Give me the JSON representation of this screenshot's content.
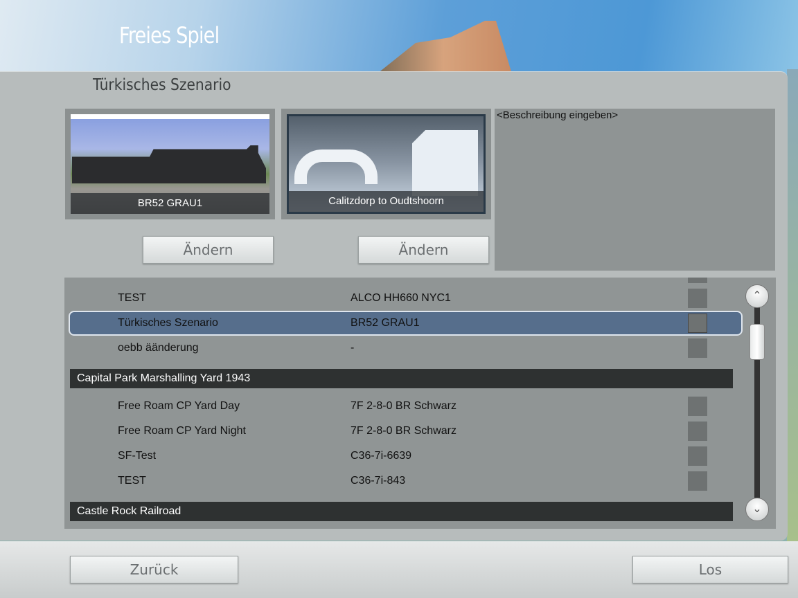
{
  "header": {
    "title": "Freies Spiel"
  },
  "scenario": {
    "name": "Türkisches Szenario",
    "description": "<Beschreibung eingeben>"
  },
  "loco": {
    "caption": "BR52 GRAU1",
    "change_label": "Ändern"
  },
  "route": {
    "caption": "Calitzdorp to Oudtshoorn",
    "change_label": "Ändern"
  },
  "list": {
    "group0_rows": [
      {
        "name": "TEST",
        "vehicle": "ALCO HH660 NYC1"
      },
      {
        "name": "Türkisches Szenario",
        "vehicle": "BR52 GRAU1"
      },
      {
        "name": "oebb äänderung",
        "vehicle": "-"
      }
    ],
    "group1": {
      "title": "Capital Park Marshalling Yard 1943",
      "rows": [
        {
          "name": "Free Roam CP Yard Day",
          "vehicle": "7F 2-8-0 BR Schwarz"
        },
        {
          "name": "Free Roam CP Yard Night",
          "vehicle": "7F 2-8-0 BR Schwarz"
        },
        {
          "name": "SF-Test",
          "vehicle": "C36-7i-6639"
        },
        {
          "name": "TEST",
          "vehicle": "C36-7i-843"
        }
      ]
    },
    "group2": {
      "title": "Castle Rock Railroad"
    }
  },
  "footer": {
    "back_label": "Zurück",
    "go_label": "Los"
  }
}
